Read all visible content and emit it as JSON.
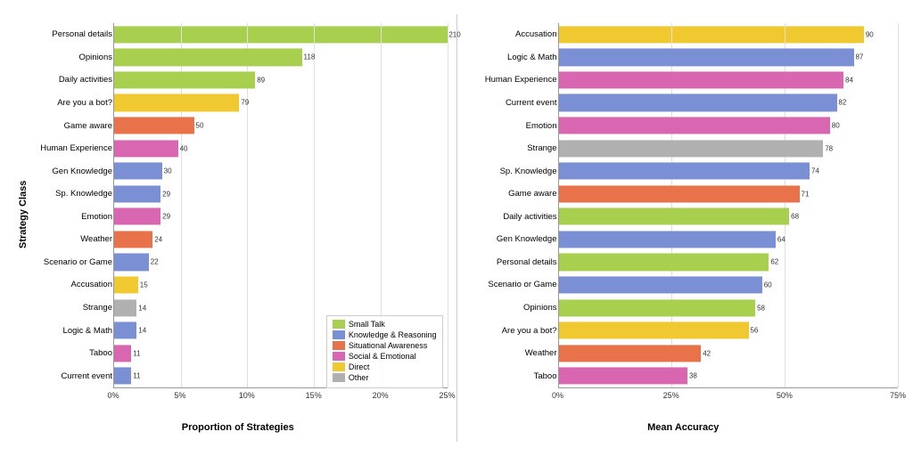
{
  "charts": {
    "left": {
      "title": "Proportion of Strategies",
      "y_axis_label": "Strategy Class",
      "x_axis_label": "Proportion of Strategies",
      "x_ticks": [
        "0%",
        "5%",
        "10%",
        "15%",
        "20%",
        "25%"
      ],
      "x_max": 25,
      "bars": [
        {
          "label": "Personal details",
          "value": 210,
          "pct": 25,
          "color": "#a8d04e"
        },
        {
          "label": "Opinions",
          "value": 118,
          "pct": 14.1,
          "color": "#a8d04e"
        },
        {
          "label": "Daily activities",
          "value": 89,
          "pct": 10.6,
          "color": "#a8d04e"
        },
        {
          "label": "Are you a bot?",
          "value": 79,
          "pct": 9.4,
          "color": "#f0c830"
        },
        {
          "label": "Game aware",
          "value": 50,
          "pct": 6.0,
          "color": "#e8724a"
        },
        {
          "label": "Human Experience",
          "value": 40,
          "pct": 4.8,
          "color": "#d966b0"
        },
        {
          "label": "Gen Knowledge",
          "value": 30,
          "pct": 3.6,
          "color": "#7b8fd4"
        },
        {
          "label": "Sp. Knowledge",
          "value": 29,
          "pct": 3.5,
          "color": "#7b8fd4"
        },
        {
          "label": "Emotion",
          "value": 29,
          "pct": 3.5,
          "color": "#d966b0"
        },
        {
          "label": "Weather",
          "value": 24,
          "pct": 2.9,
          "color": "#e8724a"
        },
        {
          "label": "Scenario or Game",
          "value": 22,
          "pct": 2.6,
          "color": "#7b8fd4"
        },
        {
          "label": "Accusation",
          "value": 15,
          "pct": 1.8,
          "color": "#f0c830"
        },
        {
          "label": "Strange",
          "value": 14,
          "pct": 1.7,
          "color": "#b0b0b0"
        },
        {
          "label": "Logic & Math",
          "value": 14,
          "pct": 1.7,
          "color": "#7b8fd4"
        },
        {
          "label": "Taboo",
          "value": 11,
          "pct": 1.3,
          "color": "#d966b0"
        },
        {
          "label": "Current event",
          "value": 11,
          "pct": 1.3,
          "color": "#7b8fd4"
        }
      ],
      "legend": [
        {
          "label": "Small Talk",
          "color": "#a8d04e"
        },
        {
          "label": "Knowledge & Reasoning",
          "color": "#7b8fd4"
        },
        {
          "label": "Situational Awareness",
          "color": "#e8724a"
        },
        {
          "label": "Social & Emotional",
          "color": "#d966b0"
        },
        {
          "label": "Direct",
          "color": "#f0c830"
        },
        {
          "label": "Other",
          "color": "#b0b0b0"
        }
      ]
    },
    "right": {
      "title": "Mean Accuracy",
      "y_axis_label": "",
      "x_axis_label": "Mean Accuracy",
      "x_ticks": [
        "0%",
        "25%",
        "50%",
        "75%"
      ],
      "x_max": 100,
      "bars": [
        {
          "label": "Accusation",
          "value": 90,
          "pct": 90,
          "color": "#f0c830"
        },
        {
          "label": "Logic & Math",
          "value": 87,
          "pct": 87,
          "color": "#7b8fd4"
        },
        {
          "label": "Human Experience",
          "value": 84,
          "pct": 84,
          "color": "#d966b0"
        },
        {
          "label": "Current event",
          "value": 82,
          "pct": 82,
          "color": "#7b8fd4"
        },
        {
          "label": "Emotion",
          "value": 80,
          "pct": 80,
          "color": "#d966b0"
        },
        {
          "label": "Strange",
          "value": 78,
          "pct": 78,
          "color": "#b0b0b0"
        },
        {
          "label": "Sp. Knowledge",
          "value": 74,
          "pct": 74,
          "color": "#7b8fd4"
        },
        {
          "label": "Game aware",
          "value": 71,
          "pct": 71,
          "color": "#e8724a"
        },
        {
          "label": "Daily activities",
          "value": 68,
          "pct": 68,
          "color": "#a8d04e"
        },
        {
          "label": "Gen Knowledge",
          "value": 64,
          "pct": 64,
          "color": "#7b8fd4"
        },
        {
          "label": "Personal details",
          "value": 62,
          "pct": 62,
          "color": "#a8d04e"
        },
        {
          "label": "Scenario or Game",
          "value": 60,
          "pct": 60,
          "color": "#7b8fd4"
        },
        {
          "label": "Opinions",
          "value": 58,
          "pct": 58,
          "color": "#a8d04e"
        },
        {
          "label": "Are you a bot?",
          "value": 56,
          "pct": 56,
          "color": "#f0c830"
        },
        {
          "label": "Weather",
          "value": 42,
          "pct": 42,
          "color": "#e8724a"
        },
        {
          "label": "Taboo",
          "value": 38,
          "pct": 38,
          "color": "#d966b0"
        }
      ]
    }
  }
}
